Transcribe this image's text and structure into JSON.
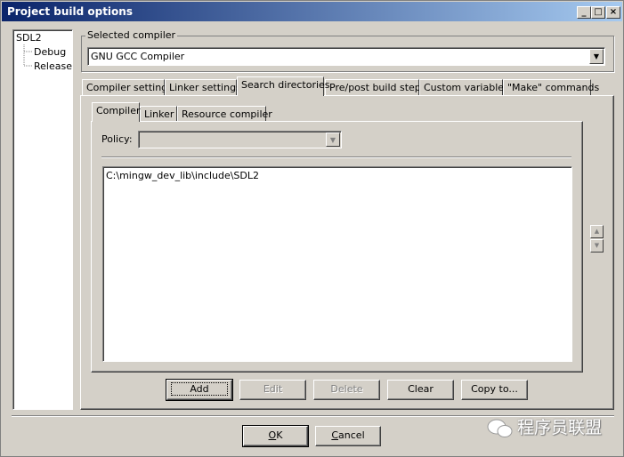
{
  "window": {
    "title": "Project build options",
    "controls": {
      "minimize": "_",
      "maximize": "□",
      "close": "×"
    }
  },
  "tree": {
    "root": "SDL2",
    "children": [
      "Debug",
      "Release"
    ]
  },
  "compiler_group": {
    "label": "Selected compiler",
    "value": "GNU GCC Compiler"
  },
  "main_tabs": [
    "Compiler settings",
    "Linker settings",
    "Search directories",
    "Pre/post build steps",
    "Custom variables",
    "\"Make\" commands"
  ],
  "active_main_tab": "Search directories",
  "sub_tabs": [
    "Compiler",
    "Linker",
    "Resource compiler"
  ],
  "active_sub_tab": "Compiler",
  "policy": {
    "label": "Policy:",
    "value": ""
  },
  "directories": [
    "C:\\mingw_dev_lib\\include\\SDL2"
  ],
  "list_buttons": {
    "add": "Add",
    "edit": "Edit",
    "delete": "Delete",
    "clear": "Clear",
    "copy_to": "Copy to..."
  },
  "dialog_buttons": {
    "ok_mnemonic": "O",
    "ok_rest": "K",
    "cancel_mnemonic": "C",
    "cancel_rest": "ancel"
  },
  "watermark": "程序员联盟"
}
